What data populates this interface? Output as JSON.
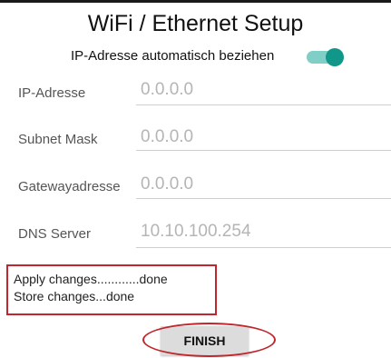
{
  "title": "WiFi / Ethernet Setup",
  "dhcp": {
    "label": "IP-Adresse automatisch beziehen",
    "enabled": true
  },
  "fields": {
    "ip": {
      "label": "IP-Adresse",
      "value": "0.0.0.0"
    },
    "subnet": {
      "label": "Subnet Mask",
      "value": "0.0.0.0"
    },
    "gateway": {
      "label": "Gatewayadresse",
      "value": "0.0.0.0"
    },
    "dns": {
      "label": "DNS Server",
      "value": "10.10.100.254"
    }
  },
  "status": {
    "line1": "Apply changes............done",
    "line2": "Store changes...done"
  },
  "finish_label": "FINISH",
  "colors": {
    "accent": "#10978a",
    "annotation": "#c0262b"
  }
}
